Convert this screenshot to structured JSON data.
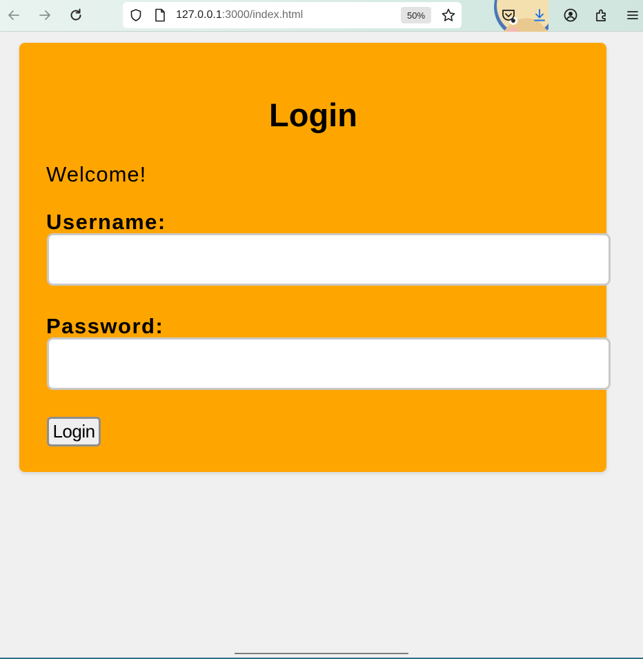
{
  "browser": {
    "url_host": "127.0.0.1",
    "url_path": ":3000/index.html",
    "zoom_level": "50%"
  },
  "login_form": {
    "title": "Login",
    "welcome_text": "Welcome!",
    "username_label": "Username:",
    "username_value": "",
    "password_label": "Password:",
    "password_value": "",
    "submit_label": "Login"
  },
  "colors": {
    "card_background": "#ffa500",
    "page_background": "#f0f0f0"
  }
}
